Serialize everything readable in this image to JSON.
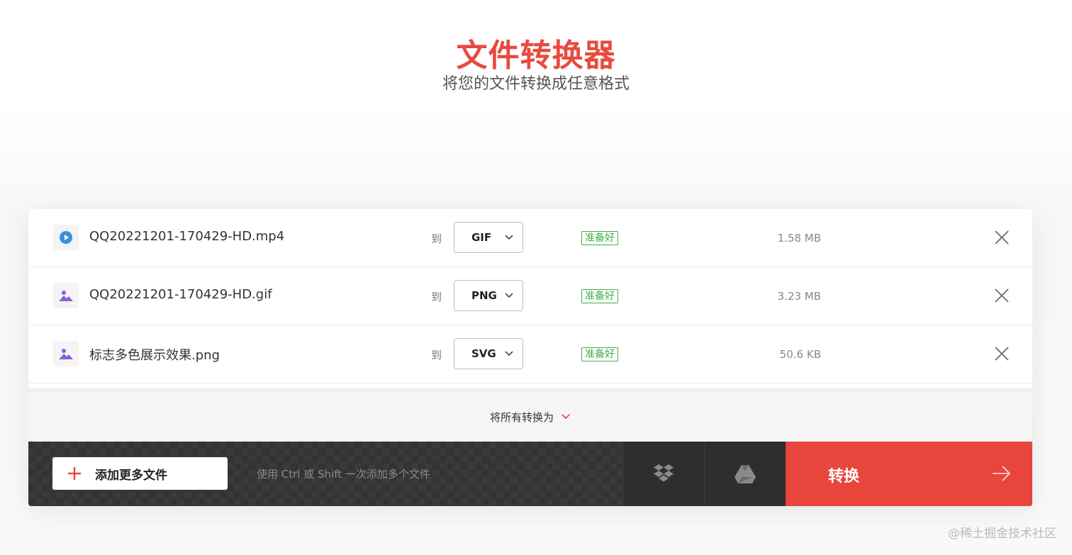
{
  "header": {
    "title": "文件转换器",
    "subtitle": "将您的文件转换成任意格式"
  },
  "files": [
    {
      "icon": "video-icon",
      "name": "QQ20221201-170429-HD.mp4",
      "to_label": "到",
      "format": "GIF",
      "status": "准备好",
      "size": "1.58 MB"
    },
    {
      "icon": "image-icon",
      "name": "QQ20221201-170429-HD.gif",
      "to_label": "到",
      "format": "PNG",
      "status": "准备好",
      "size": "3.23 MB"
    },
    {
      "icon": "image-icon",
      "name": "标志多色展示效果.png",
      "to_label": "到",
      "format": "SVG",
      "status": "准备好",
      "size": "50.6 KB"
    }
  ],
  "convert_all": {
    "label": "将所有转换为"
  },
  "actions": {
    "add_files_label": "添加更多文件",
    "hint": "使用 Ctrl 或 Shift 一次添加多个文件",
    "dropbox_icon": "dropbox-icon",
    "drive_icon": "google-drive-icon",
    "convert_label": "转换"
  },
  "watermark": "@稀土掘金技术社区",
  "colors": {
    "accent": "#e8453c",
    "ready": "#3fae4a",
    "video_icon": "#3b8fe0",
    "image_icon": "#8a5fd8"
  }
}
